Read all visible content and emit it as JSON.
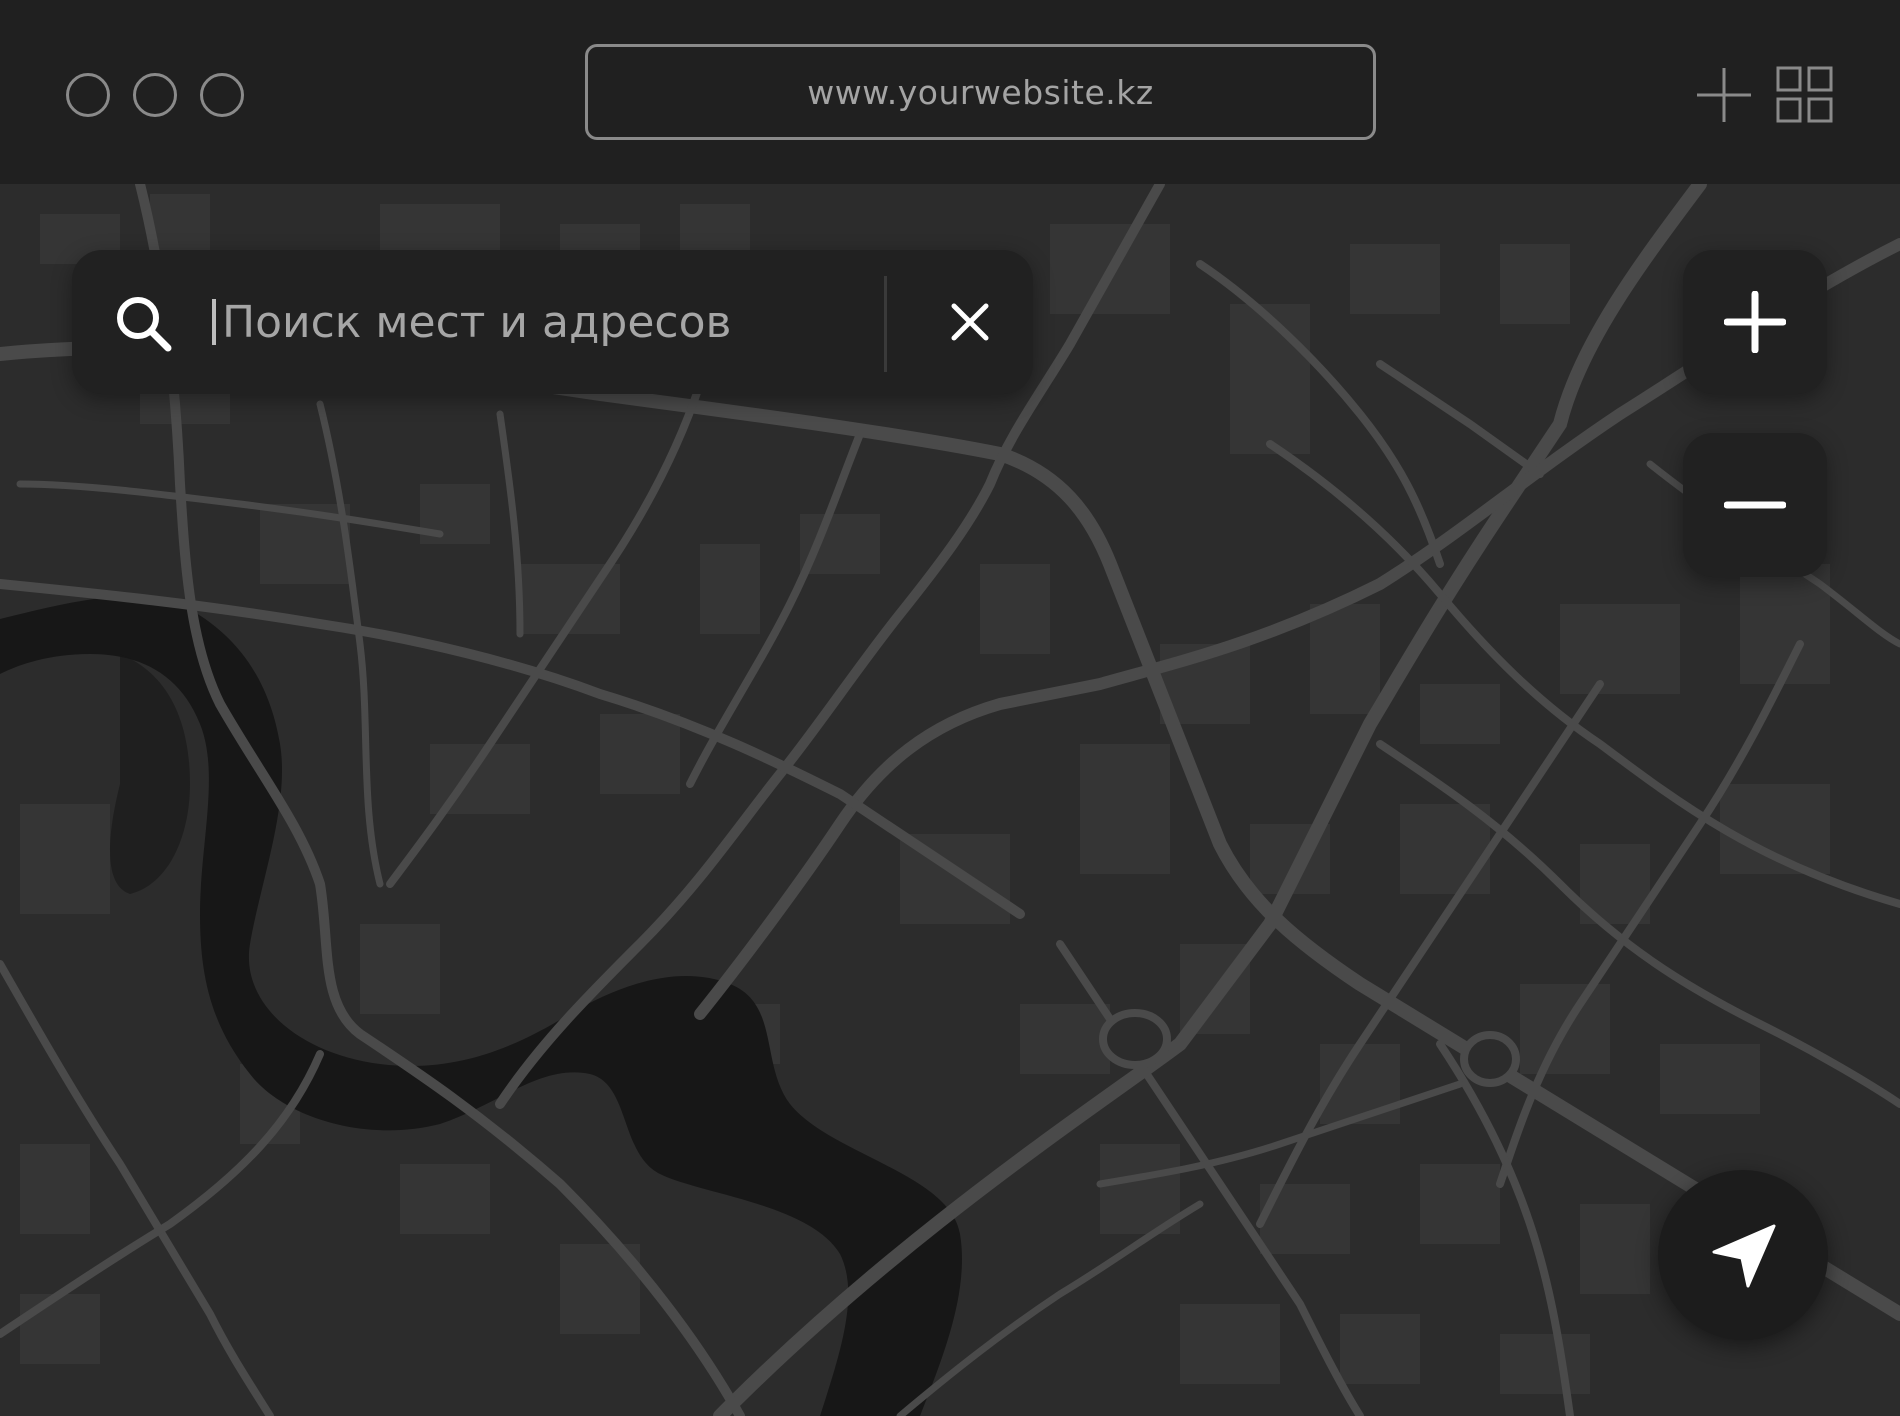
{
  "browser": {
    "url": "www.yourwebsite.kz",
    "window_controls": [
      "circle",
      "circle",
      "circle"
    ],
    "toolbar_icons": [
      "plus-icon",
      "grid-icon"
    ]
  },
  "search": {
    "placeholder": "Поиск мест и адресов",
    "icon": "search-icon",
    "clear_icon": "close-icon"
  },
  "map_controls": {
    "zoom_in_icon": "plus-icon",
    "zoom_out_icon": "minus-icon",
    "locate_icon": "navigation-arrow-icon"
  },
  "colors": {
    "background": "#202020",
    "map_land": "#2c2c2c",
    "water": "#171717",
    "roads": "#4a4a4a",
    "buildings": "#353535",
    "control_bg": "#212121",
    "icon": "#ffffff"
  }
}
